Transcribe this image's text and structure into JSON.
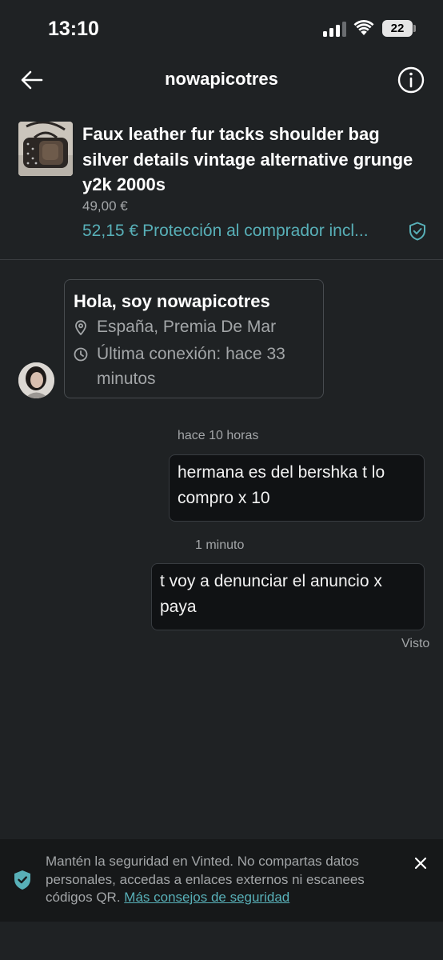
{
  "status_bar": {
    "time": "13:10",
    "battery": "22"
  },
  "header": {
    "title": "nowapicotres"
  },
  "item": {
    "title": "Faux leather fur tacks shoulder bag silver details vintage alternative grunge y2k 2000s",
    "price": "49,00 €",
    "total_price": "52,15 €",
    "protection_text": "Protección al comprador incl..."
  },
  "intro": {
    "greeting": "Hola, soy nowapicotres",
    "location": "España, Premia De Mar",
    "last_seen": "Última conexión: hace 33 minutos"
  },
  "messages": [
    {
      "time": "hace 10 horas",
      "text": "hermana es del bershka t lo compro x 10"
    },
    {
      "time": "1 minuto",
      "text": "t voy a denunciar el anuncio x paya"
    }
  ],
  "seen_label": "Visto",
  "safety_banner": {
    "text": "Mantén la seguridad en Vinted. No compartas datos personales, accedas a enlaces externos ni escanees códigos QR.",
    "link": "Más consejos de seguridad"
  },
  "colors": {
    "accent": "#58b0b8",
    "background": "#1f2224",
    "bubble": "#101214"
  }
}
